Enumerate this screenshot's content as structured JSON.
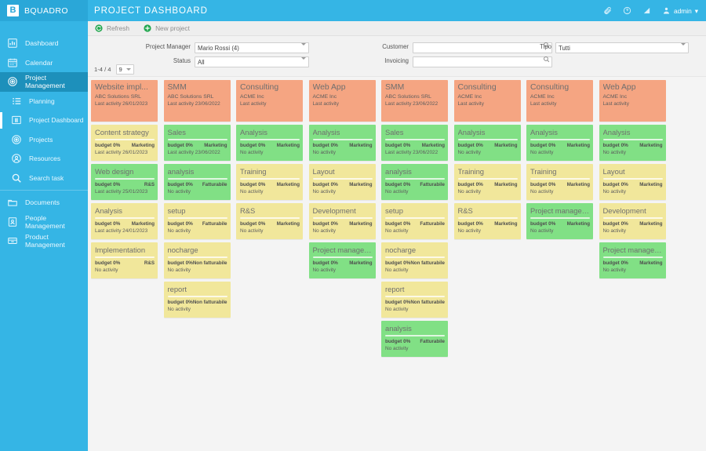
{
  "brand": {
    "logo_text": "B",
    "name": "BQUADRO",
    "logo_icon": "bquadro-logo-icon"
  },
  "header": {
    "title": "PROJECT DASHBOARD",
    "user_label": "admin",
    "icons": [
      "attachment-icon",
      "help-icon",
      "signal-icon",
      "user-icon"
    ]
  },
  "sidebar": {
    "items": [
      {
        "label": "Dashboard",
        "icon": "chart-bar-icon",
        "level": "top",
        "state": "normal"
      },
      {
        "label": "Calendar",
        "icon": "calendar-icon",
        "level": "top",
        "state": "normal"
      },
      {
        "label": "Project Management",
        "icon": "target-icon",
        "level": "top",
        "state": "active"
      },
      {
        "label": "Planning",
        "icon": "list-icon",
        "level": "sub",
        "state": "normal"
      },
      {
        "label": "Project Dashboard",
        "icon": "dashboard-panels-icon",
        "level": "sub",
        "state": "current"
      },
      {
        "label": "Projects",
        "icon": "target-icon",
        "level": "sub",
        "state": "normal"
      },
      {
        "label": "Resources",
        "icon": "person-circle-icon",
        "level": "sub",
        "state": "normal"
      },
      {
        "label": "Search task",
        "icon": "search-icon",
        "level": "sub",
        "state": "normal"
      },
      {
        "label": "Documents",
        "icon": "folder-icon",
        "level": "top",
        "state": "normal"
      },
      {
        "label": "People Management",
        "icon": "id-card-icon",
        "level": "top",
        "state": "normal"
      },
      {
        "label": "Product Management",
        "icon": "box-icon",
        "level": "top",
        "state": "normal"
      }
    ]
  },
  "toolbar": {
    "refresh_label": "Refresh",
    "refresh_icon": "refresh-circle-icon",
    "new_project_label": "New project",
    "new_project_icon": "plus-circle-icon"
  },
  "filters": {
    "project_manager": {
      "label": "Project Manager",
      "value": "Mario Rossi (4)"
    },
    "status": {
      "label": "Status",
      "value": "All"
    },
    "customer": {
      "label": "Customer",
      "value": "",
      "placeholder": "",
      "icon": "search-icon"
    },
    "invoicing": {
      "label": "Invoicing",
      "value": "",
      "placeholder": "",
      "icon": "search-icon"
    },
    "tipo": {
      "label": "Tipo",
      "value": "Tutti"
    }
  },
  "pager": {
    "count_text": "1-4 / 4",
    "page_size": "9"
  },
  "colors": {
    "brand_blue": "#35b5e5",
    "brand_blue_dark": "#1d90bb",
    "project_card": "#f5a582",
    "task_yellow": "#f1e79b",
    "task_green": "#81e085",
    "board_bg": "#f4f4f4"
  },
  "board": {
    "columns": [
      {
        "project": {
          "title": "Website impl...",
          "customer": "ABC Solutions SRL",
          "activity": "Last activity 26/01/2023"
        },
        "tasks": [
          {
            "title": "Content strategy",
            "budget": "budget 0%",
            "tag": "Marketing",
            "activity": "Last activity 26/01/2023",
            "color": "yellow"
          },
          {
            "title": "Web design",
            "budget": "budget 0%",
            "tag": "R&S",
            "activity": "Last activity 25/01/2023",
            "color": "green"
          },
          {
            "title": "Analysis",
            "budget": "budget 0%",
            "tag": "Marketing",
            "activity": "Last activity 24/01/2023",
            "color": "yellow"
          },
          {
            "title": "Implementation",
            "budget": "budget 0%",
            "tag": "R&S",
            "activity": "No activity",
            "color": "yellow"
          }
        ]
      },
      {
        "project": {
          "title": "SMM",
          "customer": "ABC Solutions SRL",
          "activity": "Last activity 23/06/2022"
        },
        "tasks": [
          {
            "title": "Sales",
            "budget": "budget 0%",
            "tag": "Marketing",
            "activity": "Last activity 23/06/2022",
            "color": "green"
          },
          {
            "title": "analysis",
            "budget": "budget 0%",
            "tag": "Fatturabile",
            "activity": "No activity",
            "color": "green"
          },
          {
            "title": "setup",
            "budget": "budget 0%",
            "tag": "Fatturabile",
            "activity": "No activity",
            "color": "yellow"
          },
          {
            "title": "nocharge",
            "budget": "budget 0%",
            "tag": "Non fatturabile",
            "activity": "No activity",
            "color": "yellow"
          },
          {
            "title": "report",
            "budget": "budget 0%",
            "tag": "Non fatturabile",
            "activity": "No activity",
            "color": "yellow"
          }
        ]
      },
      {
        "project": {
          "title": "Consulting",
          "customer": "ACME Inc",
          "activity": "Last activity"
        },
        "tasks": [
          {
            "title": "Analysis",
            "budget": "budget 0%",
            "tag": "Marketing",
            "activity": "No activity",
            "color": "green"
          },
          {
            "title": "Training",
            "budget": "budget 0%",
            "tag": "Marketing",
            "activity": "No activity",
            "color": "yellow"
          },
          {
            "title": "R&S",
            "budget": "budget 0%",
            "tag": "Marketing",
            "activity": "No activity",
            "color": "yellow"
          }
        ]
      },
      {
        "project": {
          "title": "Web App",
          "customer": "ACME Inc",
          "activity": "Last activity"
        },
        "tasks": [
          {
            "title": "Analysis",
            "budget": "budget 0%",
            "tag": "Marketing",
            "activity": "No activity",
            "color": "green"
          },
          {
            "title": "Layout",
            "budget": "budget 0%",
            "tag": "Marketing",
            "activity": "No activity",
            "color": "yellow"
          },
          {
            "title": "Development",
            "budget": "budget 0%",
            "tag": "Marketing",
            "activity": "No activity",
            "color": "yellow"
          },
          {
            "title": "Project managem...",
            "budget": "budget 0%",
            "tag": "Marketing",
            "activity": "No activity",
            "color": "green"
          }
        ]
      },
      {
        "project": {
          "title": "SMM",
          "customer": "ABC Solutions SRL",
          "activity": "Last activity 23/06/2022"
        },
        "tasks": [
          {
            "title": "Sales",
            "budget": "budget 0%",
            "tag": "Marketing",
            "activity": "Last activity 23/06/2022",
            "color": "green"
          },
          {
            "title": "analysis",
            "budget": "budget 0%",
            "tag": "Fatturabile",
            "activity": "No activity",
            "color": "green"
          },
          {
            "title": "setup",
            "budget": "budget 0%",
            "tag": "Fatturabile",
            "activity": "No activity",
            "color": "yellow"
          },
          {
            "title": "nocharge",
            "budget": "budget 0%",
            "tag": "Non fatturabile",
            "activity": "No activity",
            "color": "yellow"
          },
          {
            "title": "report",
            "budget": "budget 0%",
            "tag": "Non fatturabile",
            "activity": "No activity",
            "color": "yellow"
          },
          {
            "title": "analysis",
            "budget": "budget 0%",
            "tag": "Fatturabile",
            "activity": "No activity",
            "color": "green"
          }
        ]
      },
      {
        "project": {
          "title": "Consulting",
          "customer": "ACME Inc",
          "activity": "Last activity"
        },
        "tasks": [
          {
            "title": "Analysis",
            "budget": "budget 0%",
            "tag": "Marketing",
            "activity": "No activity",
            "color": "green"
          },
          {
            "title": "Training",
            "budget": "budget 0%",
            "tag": "Marketing",
            "activity": "No activity",
            "color": "yellow"
          },
          {
            "title": "R&S",
            "budget": "budget 0%",
            "tag": "Marketing",
            "activity": "No activity",
            "color": "yellow"
          }
        ]
      },
      {
        "project": {
          "title": "Consulting",
          "customer": "ACME Inc",
          "activity": "Last activity"
        },
        "tasks": [
          {
            "title": "Analysis",
            "budget": "budget 0%",
            "tag": "Marketing",
            "activity": "No activity",
            "color": "green"
          },
          {
            "title": "Training",
            "budget": "budget 0%",
            "tag": "Marketing",
            "activity": "No activity",
            "color": "yellow"
          },
          {
            "title": "Project managem...",
            "budget": "budget 0%",
            "tag": "Marketing",
            "activity": "No activity",
            "color": "green"
          }
        ]
      },
      {
        "project": {
          "title": "Web App",
          "customer": "ACME Inc",
          "activity": "Last activity"
        },
        "tasks": [
          {
            "title": "Analysis",
            "budget": "budget 0%",
            "tag": "Marketing",
            "activity": "No activity",
            "color": "green"
          },
          {
            "title": "Layout",
            "budget": "budget 0%",
            "tag": "Marketing",
            "activity": "No activity",
            "color": "yellow"
          },
          {
            "title": "Development",
            "budget": "budget 0%",
            "tag": "Marketing",
            "activity": "No activity",
            "color": "yellow"
          },
          {
            "title": "Project managem...",
            "budget": "budget 0%",
            "tag": "Marketing",
            "activity": "No activity",
            "color": "green"
          }
        ]
      }
    ]
  }
}
